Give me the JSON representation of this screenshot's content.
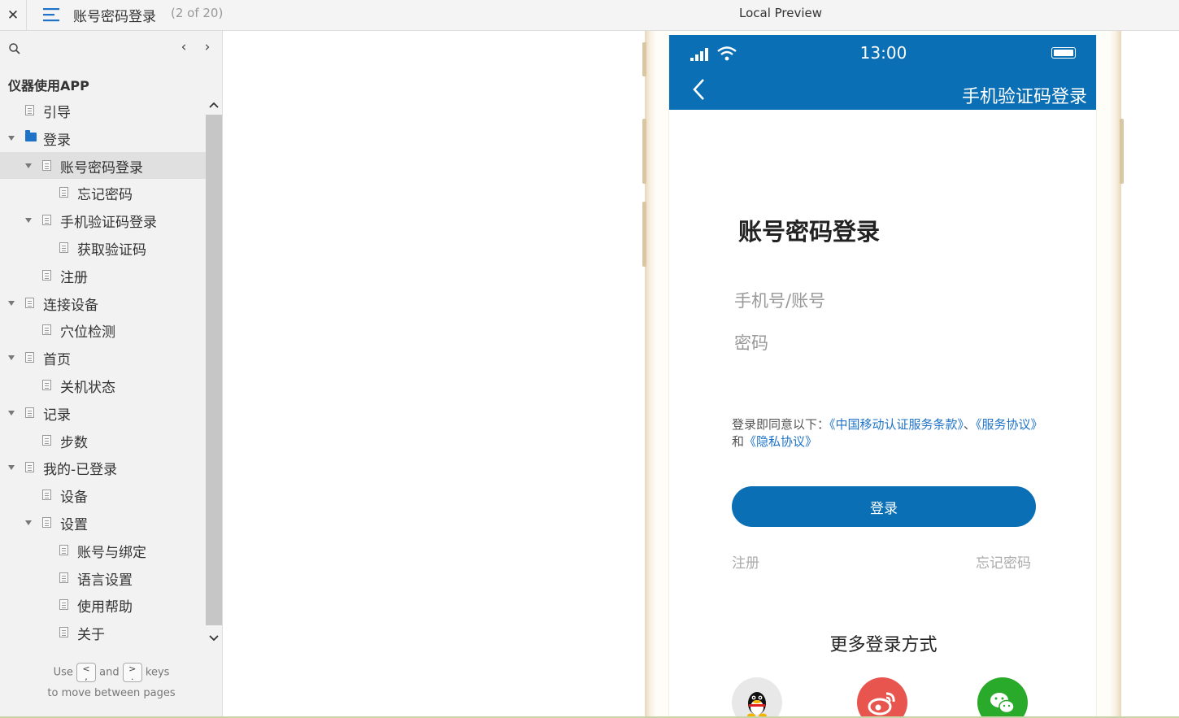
{
  "topbar": {
    "close_glyph": "✕",
    "page_title": "账号密码登录",
    "page_count": "(2 of 20)",
    "preview_title": "Local Preview"
  },
  "sidebar": {
    "project_title": "仪器使用APP",
    "nav_prev_glyph": "‹",
    "nav_next_glyph": "›",
    "tree": [
      {
        "label": "引导",
        "level": 1,
        "arrow": false,
        "icon": "page-icon"
      },
      {
        "label": "登录",
        "level": 1,
        "arrow": true,
        "icon": "folder-icon"
      },
      {
        "label": "账号密码登录",
        "level": 2,
        "arrow": true,
        "icon": "page-icon",
        "selected": true
      },
      {
        "label": "忘记密码",
        "level": 3,
        "arrow": false,
        "icon": "page-icon"
      },
      {
        "label": "手机验证码登录",
        "level": 2,
        "arrow": true,
        "icon": "page-icon"
      },
      {
        "label": "获取验证码",
        "level": 3,
        "arrow": false,
        "icon": "page-icon"
      },
      {
        "label": "注册",
        "level": 2,
        "arrow": false,
        "icon": "page-icon"
      },
      {
        "label": "连接设备",
        "level": 1,
        "arrow": true,
        "icon": "page-icon"
      },
      {
        "label": "穴位检测",
        "level": 2,
        "arrow": false,
        "icon": "page-icon"
      },
      {
        "label": "首页",
        "level": 1,
        "arrow": true,
        "icon": "page-icon"
      },
      {
        "label": "关机状态",
        "level": 2,
        "arrow": false,
        "icon": "page-icon"
      },
      {
        "label": "记录",
        "level": 1,
        "arrow": true,
        "icon": "page-icon"
      },
      {
        "label": "步数",
        "level": 2,
        "arrow": false,
        "icon": "page-icon"
      },
      {
        "label": "我的-已登录",
        "level": 1,
        "arrow": true,
        "icon": "page-icon"
      },
      {
        "label": "设备",
        "level": 2,
        "arrow": false,
        "icon": "page-icon"
      },
      {
        "label": "设置",
        "level": 2,
        "arrow": true,
        "icon": "page-icon"
      },
      {
        "label": "账号与绑定",
        "level": 3,
        "arrow": false,
        "icon": "page-icon"
      },
      {
        "label": "语言设置",
        "level": 3,
        "arrow": false,
        "icon": "page-icon"
      },
      {
        "label": "使用帮助",
        "level": 3,
        "arrow": false,
        "icon": "page-icon"
      },
      {
        "label": "关于",
        "level": 3,
        "arrow": false,
        "icon": "page-icon"
      }
    ],
    "hint": {
      "use": "Use",
      "key_prev": "<\n,",
      "and": "and",
      "key_next": ">\n.",
      "keys": "keys",
      "line2": "to move between pages"
    }
  },
  "phone": {
    "status_time": "13:00",
    "appbar_title": "手机验证码登录",
    "heading": "账号密码登录",
    "user_placeholder": "手机号/账号",
    "password_placeholder": "密码",
    "agree_prefix": "登录即同意以下：",
    "agree_link1": "《中国移动认证服务条款》",
    "agree_sep": "、",
    "agree_link2": "《服务协议》",
    "agree_and": "和",
    "agree_link3": "《隐私协议》",
    "login_button": "登录",
    "register_link": "注册",
    "forgot_link": "忘记密码",
    "more_title": "更多登录方式",
    "social": [
      "qq-icon",
      "weibo-icon",
      "wechat-icon"
    ]
  },
  "colors": {
    "brand_blue": "#0a6fb5",
    "link_blue": "#1e73c8",
    "weibo_red": "#e8544e",
    "wechat_green": "#2aaa2a"
  }
}
